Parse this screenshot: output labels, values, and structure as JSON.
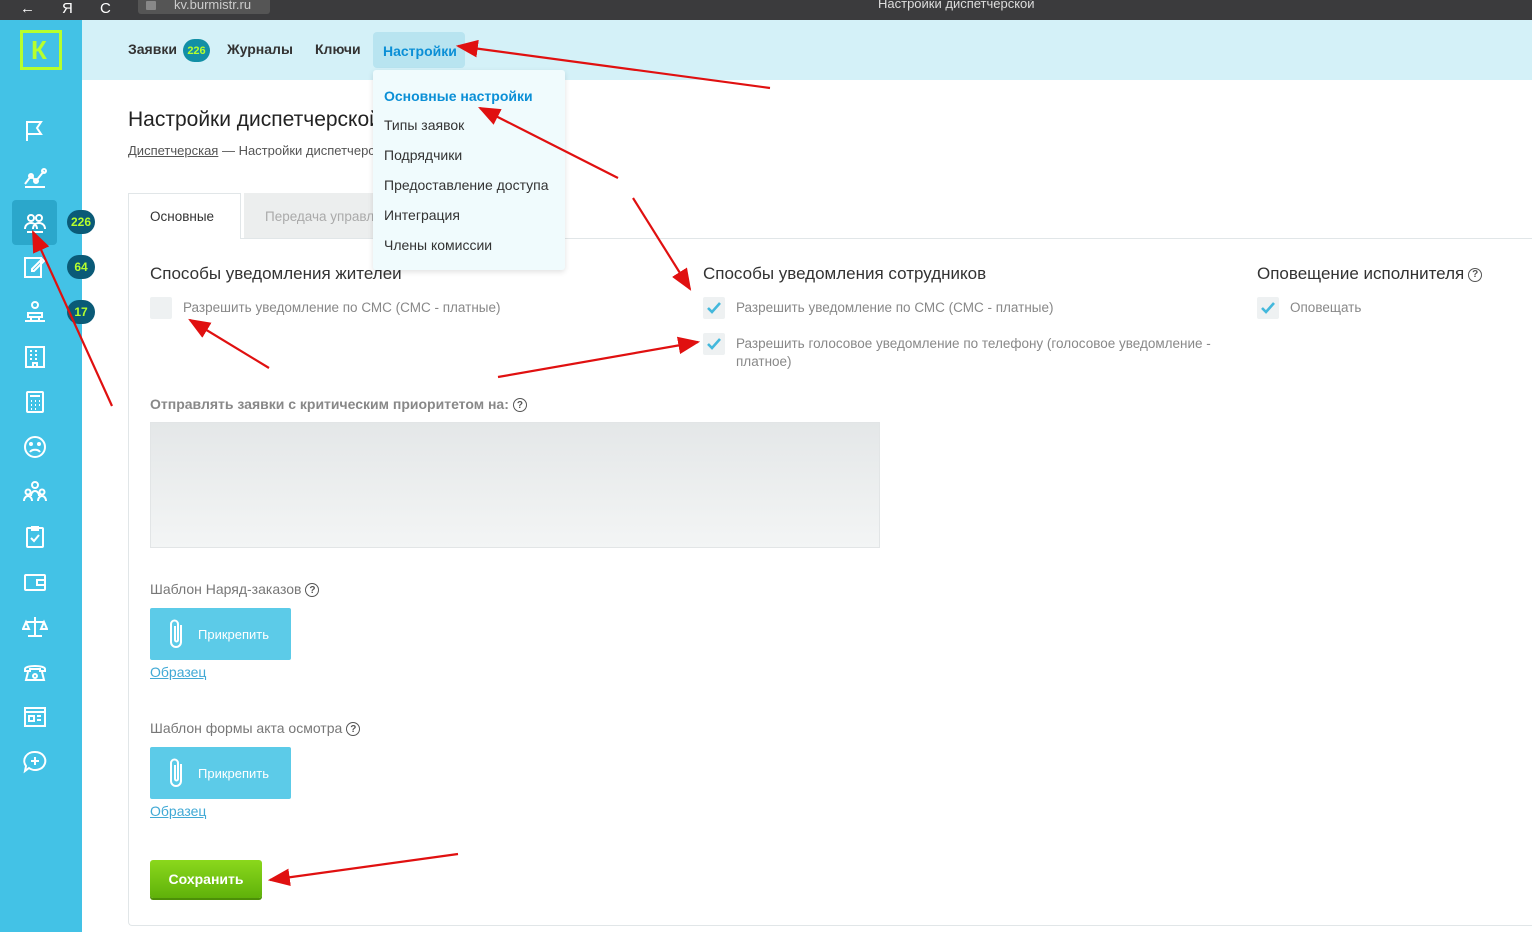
{
  "browser": {
    "back": "←",
    "yandex": "Я",
    "reload": "C",
    "url": "kv.burmistr.ru",
    "window_title": "Настройки диспетчерской"
  },
  "logo": "К",
  "sidebar_badges": [
    "226",
    "64",
    "17"
  ],
  "topnav": {
    "requests": "Заявки",
    "requests_badge": "226",
    "journals": "Журналы",
    "keys": "Ключи",
    "settings": "Настройки"
  },
  "dropdown": [
    "Основные настройки",
    "Типы заявок",
    "Подрядчики",
    "Предоставление доступа",
    "Интеграция",
    "Члены комиссии"
  ],
  "page": {
    "title": "Настройки диспетчерской",
    "breadcrumb_link": "Диспетчерская",
    "breadcrumb_rest": " — Настройки диспетчерской"
  },
  "tabs": {
    "main": "Основные",
    "transfer": "Передача управления"
  },
  "residents": {
    "title": "Способы уведомления жителей",
    "sms": "Разрешить уведомление по СМС (СМС - платные)"
  },
  "employees": {
    "title": "Способы уведомления сотрудников",
    "sms": "Разрешить уведомление по СМС (СМС - платные)",
    "voice": "Разрешить голосовое уведомление по телефону (голосовое уведомление - платное)"
  },
  "executor": {
    "title": "Оповещение исполнителя",
    "notify": "Оповещать"
  },
  "critical_label": "Отправлять заявки с критическим приоритетом на:",
  "work_order": {
    "label": "Шаблон Наряд-заказов",
    "attach": "Прикрепить",
    "sample": "Образец"
  },
  "inspection": {
    "label": "Шаблон формы акта осмотра",
    "attach": "Прикрепить",
    "sample": "Образец"
  },
  "help_glyph": "?",
  "save": "Сохранить",
  "colors": {
    "sidebar": "#43c2e6",
    "accent_green": "#b6ff2d",
    "link_blue": "#0b8fd6",
    "save_green": "#6cc312",
    "annotation_red": "#e01010"
  }
}
